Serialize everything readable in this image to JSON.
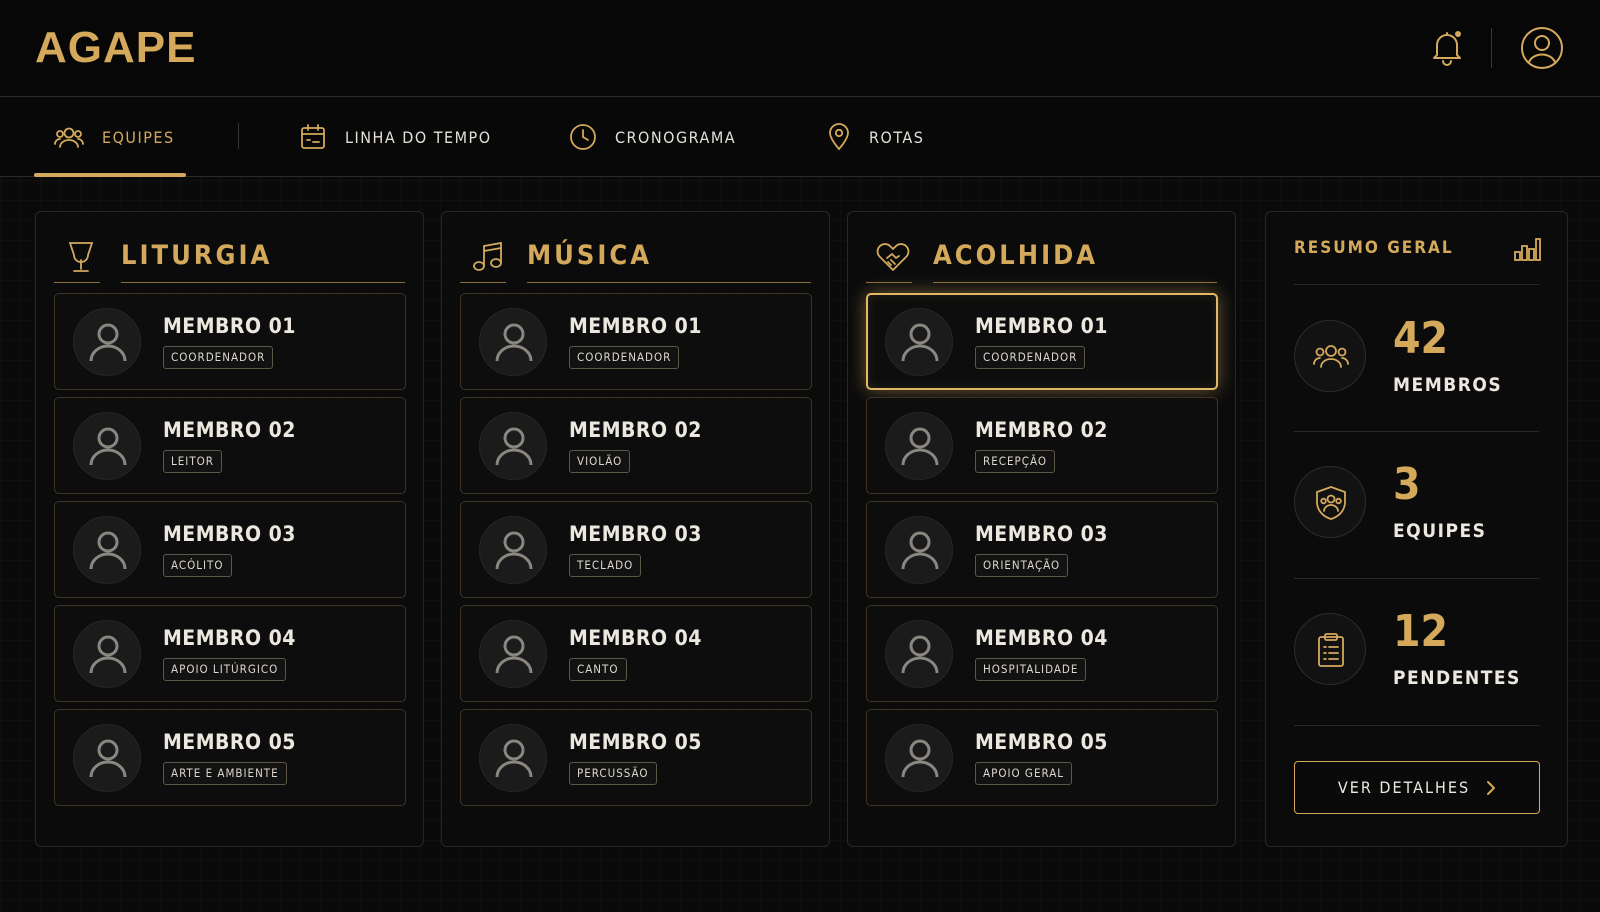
{
  "app": {
    "logo": "AGAPE"
  },
  "tabs": [
    {
      "label": "EQUIPES",
      "icon": "users-icon",
      "active": true
    },
    {
      "label": "LINHA DO TEMPO",
      "icon": "calendar-icon",
      "active": false
    },
    {
      "label": "CRONOGRAMA",
      "icon": "clock-icon",
      "active": false
    },
    {
      "label": "ROTAS",
      "icon": "map-pin-icon",
      "active": false
    }
  ],
  "teams": [
    {
      "title": "LITURGIA",
      "icon": "chalice-icon",
      "members": [
        {
          "name": "MEMBRO 01",
          "role": "COORDENADOR"
        },
        {
          "name": "MEMBRO 02",
          "role": "LEITOR"
        },
        {
          "name": "MEMBRO 03",
          "role": "ACÓLITO"
        },
        {
          "name": "MEMBRO 04",
          "role": "APOIO LITÚRGICO"
        },
        {
          "name": "MEMBRO 05",
          "role": "ARTE E AMBIENTE"
        }
      ]
    },
    {
      "title": "MÚSICA",
      "icon": "music-note-icon",
      "members": [
        {
          "name": "MEMBRO 01",
          "role": "COORDENADOR"
        },
        {
          "name": "MEMBRO 02",
          "role": "VIOLÃO"
        },
        {
          "name": "MEMBRO 03",
          "role": "TECLADO"
        },
        {
          "name": "MEMBRO 04",
          "role": "CANTO"
        },
        {
          "name": "MEMBRO 05",
          "role": "PERCUSSÃO"
        }
      ]
    },
    {
      "title": "ACOLHIDA",
      "icon": "heart-handshake-icon",
      "members": [
        {
          "name": "MEMBRO 01",
          "role": "COORDENADOR",
          "highlighted": true
        },
        {
          "name": "MEMBRO 02",
          "role": "RECEPÇÃO"
        },
        {
          "name": "MEMBRO 03",
          "role": "ORIENTAÇÃO"
        },
        {
          "name": "MEMBRO 04",
          "role": "HOSPITALIDADE"
        },
        {
          "name": "MEMBRO 05",
          "role": "APOIO GERAL"
        }
      ]
    }
  ],
  "summary": {
    "title": "RESUMO GERAL",
    "stats": [
      {
        "value": "42",
        "label": "MEMBROS",
        "icon": "users-icon"
      },
      {
        "value": "3",
        "label": "EQUIPES",
        "icon": "shield-users-icon"
      },
      {
        "value": "12",
        "label": "PENDENTES",
        "icon": "clipboard-list-icon"
      }
    ],
    "button_label": "VER DETALHES"
  },
  "colors": {
    "accent": "#d4a95c",
    "background": "#0a0a0a",
    "text": "#ece8e0"
  }
}
